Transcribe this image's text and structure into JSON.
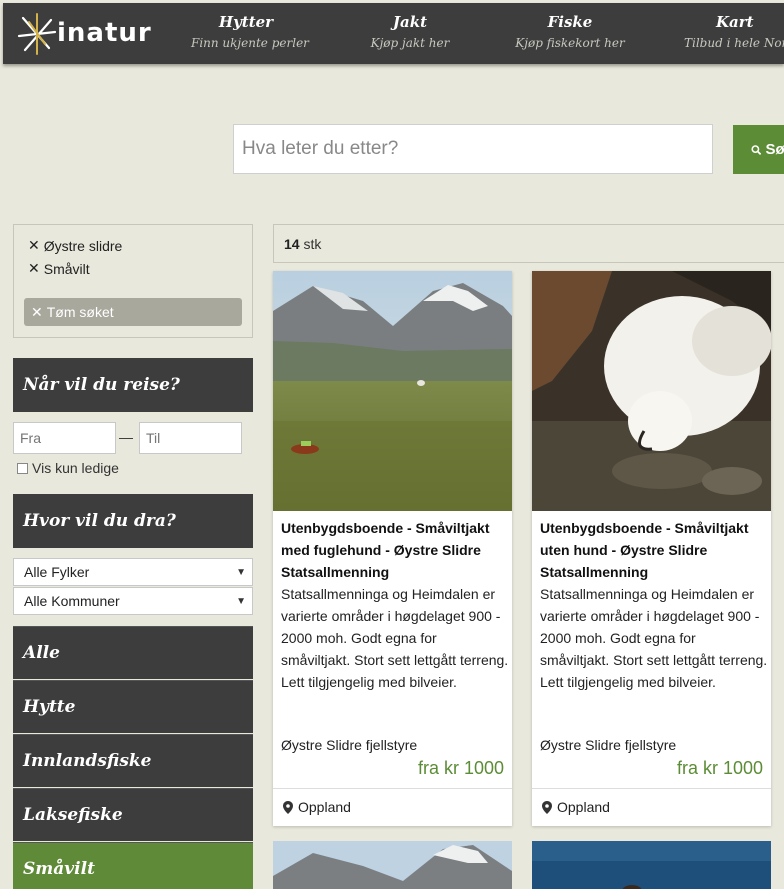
{
  "brand": {
    "name": "inatur"
  },
  "nav": [
    {
      "title": "Hytter",
      "subtitle": "Finn ukjente perler"
    },
    {
      "title": "Jakt",
      "subtitle": "Kjøp jakt her"
    },
    {
      "title": "Fiske",
      "subtitle": "Kjøp fiskekort her"
    },
    {
      "title": "Kart",
      "subtitle": "Tilbud i hele Norge"
    }
  ],
  "search": {
    "placeholder": "Hva leter du etter?",
    "button_label": "Søk"
  },
  "filters": {
    "active": [
      "Øystre slidre",
      "Småvilt"
    ],
    "clear_label": "Tøm søket"
  },
  "when": {
    "heading": "Når vil du reise?",
    "from_placeholder": "Fra",
    "to_placeholder": "Til",
    "separator": "—",
    "available_only_label": "Vis kun ledige"
  },
  "where": {
    "heading": "Hvor vil du dra?",
    "county_selected": "Alle Fylker",
    "municipality_selected": "Alle Kommuner"
  },
  "categories": [
    {
      "label": "Alle",
      "active": false
    },
    {
      "label": "Hytte",
      "active": false
    },
    {
      "label": "Innlandsfiske",
      "active": false
    },
    {
      "label": "Laksefiske",
      "active": false
    },
    {
      "label": "Småvilt",
      "active": true
    }
  ],
  "results": {
    "count": "14",
    "count_unit": "stk",
    "cards": [
      {
        "title": "Utenbygdsboende - Småviltjakt med fuglehund - Øystre Slidre Statsallmenning",
        "description": "Statsallmenninga og Heimdalen er varierte områder i høgdelaget 900 - 2000 moh. Godt egna for småviltjakt. Stort sett lettgått terreng. Lett tilgjengelig med bilveier.",
        "owner": "Øystre Slidre fjellstyre",
        "price": "fra kr 1000",
        "region": "Oppland"
      },
      {
        "title": "Utenbygdsboende - Småviltjakt uten hund - Øystre Slidre Statsallmenning",
        "description": "Statsallmenninga og Heimdalen er varierte områder i høgdelaget 900 - 2000 moh. Godt egna for småviltjakt. Stort sett lettgått terreng. Lett tilgjengelig med bilveier.",
        "owner": "Øystre Slidre fjellstyre",
        "price": "fra kr 1000",
        "region": "Oppland"
      }
    ]
  },
  "colors": {
    "header": "#3d3d3d",
    "accent": "#5c8c35",
    "background": "#e8e8dc"
  }
}
